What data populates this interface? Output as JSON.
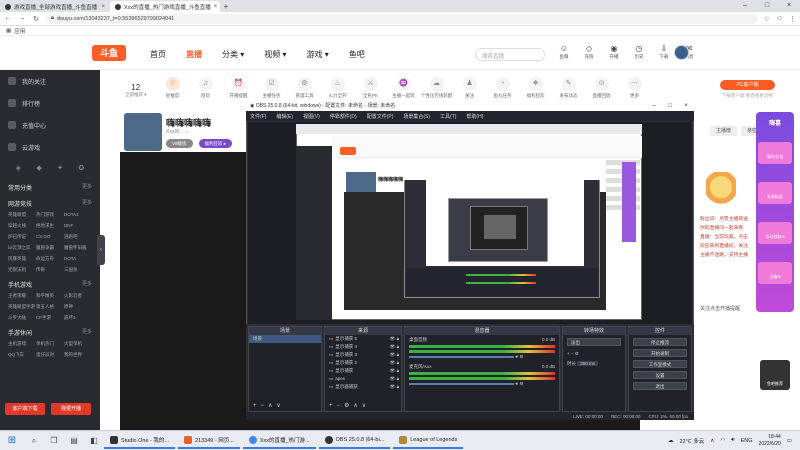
{
  "browser": {
    "tabs": [
      {
        "label": "游戏直播_全部游戏直播_斗鱼直播",
        "active": false
      },
      {
        "label": "Xxx的直播_热门游戏直播_斗鱼直播",
        "active": true
      }
    ],
    "url": "douyu.com/13043237_t=0.55396529799024041",
    "bookmark": "应用"
  },
  "site": {
    "logo": "斗鱼",
    "nav": [
      {
        "label": "首页"
      },
      {
        "label": "直播",
        "active": true
      },
      {
        "label": "分类 ▾"
      },
      {
        "label": "视频 ▾"
      },
      {
        "label": "游戏 ▾"
      },
      {
        "label": "鱼吧"
      }
    ],
    "search_placeholder": "搜索直播",
    "tools": [
      {
        "icon": "fish-icon",
        "glyph": "☺",
        "label": "鱼粮"
      },
      {
        "icon": "diamond-icon",
        "glyph": "◇",
        "label": "充值"
      },
      {
        "icon": "broadcast-icon",
        "glyph": "◉",
        "label": "开播"
      },
      {
        "icon": "history-icon",
        "glyph": "◷",
        "label": "历史"
      },
      {
        "icon": "download-icon",
        "glyph": "⇩",
        "label": "下载"
      },
      {
        "icon": "message-icon",
        "glyph": "✉",
        "label": "消息"
      }
    ]
  },
  "sidebar": {
    "items": [
      {
        "label": "我的关注"
      },
      {
        "label": "排行榜"
      },
      {
        "label": "充值中心"
      },
      {
        "label": "云游戏"
      }
    ],
    "recommend_title": "常用分类",
    "hot_title": "网游竞技",
    "hot_more": "更多",
    "grid1": [
      "英雄联盟",
      "热门游戏",
      "DOTA2",
      "穿越火线",
      "绝地求生",
      "DNF",
      "炉石传说",
      "CS:GO",
      "逃跑吧",
      "lol云顶之弈",
      "魔兽争霸",
      "魔兽怀旧服",
      "风暴英雄",
      "命运方舟",
      "DOTA",
      "无限法则",
      "传奇",
      "三国杀"
    ],
    "mobile_title": "手机游戏",
    "grid2": [
      "王者荣耀",
      "和平精英",
      "火影忍者",
      "英雄联盟手游",
      "第五人格",
      "原神",
      "斗罗大陆",
      "CF手游",
      "崩坏3"
    ],
    "entertain_title": "手游休闲",
    "grid3": [
      "主机游戏",
      "单机热门",
      "大型单机",
      "QQ飞车",
      "蛋仔派对",
      "我的世界"
    ],
    "btn_left": "客户端下载",
    "btn_right": "我要开播"
  },
  "categories": {
    "follow_count": "12",
    "follow_label": "全部推荐 ▾",
    "items": [
      {
        "label": "星推官",
        "glyph": "☆",
        "hot": true
      },
      {
        "label": "陪玩",
        "glyph": "♫"
      },
      {
        "label": "开播提醒",
        "glyph": "⏰"
      },
      {
        "label": "主播任务",
        "glyph": "☑"
      },
      {
        "label": "管理工具",
        "glyph": "⚙"
      },
      {
        "label": "火力全开",
        "glyph": "♨"
      },
      {
        "label": "全民PK",
        "glyph": "⚔"
      },
      {
        "label": "主播一起玩",
        "glyph": "♒"
      },
      {
        "label": "个性化在线装配",
        "glyph": "☁"
      },
      {
        "label": "关注",
        "glyph": "♟"
      },
      {
        "label": "鱼丸任务",
        "glyph": "◔"
      },
      {
        "label": "福利狂欢",
        "glyph": "❖"
      },
      {
        "label": "发布动态",
        "glyph": "✎"
      },
      {
        "label": "直播回放",
        "glyph": "⊙"
      },
      {
        "label": "更多",
        "glyph": "⋯"
      }
    ],
    "pc_button": "PC客户端",
    "pc_sub": "下载客户端 看直播更流畅"
  },
  "room": {
    "title": "嗨嗨嗨嗨嗨",
    "meta": "Xxx的",
    "tag_level": "V9级房",
    "tag_hot": "福利狂欢 ▸"
  },
  "chat": {
    "tabs": [
      "主播榜",
      "亲密榜"
    ],
    "lines": [
      "粉丝说：点赞主播就送",
      "你的直播间一起来看",
      "直播：当前玩家，点击",
      "欢迎来到直播间，关注",
      "主播不迷路，支持主播"
    ],
    "bottom": "关注点击开播提醒",
    "promo_title": "嗨喜",
    "promo_items": [
      "福利/红包",
      "礼物抽奖",
      "活动领取/5",
      "宝箱/5"
    ],
    "bottom_ad": "鱼吧推荐"
  },
  "obs": {
    "title": "OBS 25.0.8 (64-bit, windows) - 配置文件: 未命名 - 场景: 未命名",
    "menu": [
      "文件(F)",
      "编辑(E)",
      "视图(V)",
      "停靠部件(D)",
      "配置文件(P)",
      "场景集合(S)",
      "工具(T)",
      "帮助(H)"
    ],
    "scenes_title": "场景",
    "scenes": [
      "场景"
    ],
    "sources_title": "来源",
    "sources": [
      "显示捕获 5",
      "显示捕获 4",
      "显示捕获 3",
      "显示捕获 2",
      "显示捕获",
      "apex",
      "显示器捕获"
    ],
    "mixer_title": "混音器",
    "mixer": [
      {
        "name": "桌面音频",
        "db": "0.0 dB"
      },
      {
        "name": "麦克风/Aux",
        "db": "0.0 dB"
      }
    ],
    "transitions_title": "转场特效",
    "transition": "淡出",
    "duration_label": "时长",
    "duration": "300 ms",
    "controls_title": "控件",
    "controls": [
      "停止推流",
      "开始录制",
      "工作室模式",
      "设置",
      "退出"
    ],
    "status": [
      "LIVE: 00:00:00",
      "REC: 00:00:00",
      "CPU: 2%, 60.00 fps"
    ]
  },
  "taskbar": {
    "apps": [
      {
        "label": "Studio One - 我的..."
      },
      {
        "label": "213349 - 网页..."
      },
      {
        "label": "Xxx的直播_热门游..."
      },
      {
        "label": "OBS 25.0.8 (64-bi..."
      },
      {
        "label": "League of Legends"
      }
    ],
    "weather": "22°C 多云",
    "lang": "ENG",
    "time": "18:44",
    "date": "2022/6/20"
  }
}
